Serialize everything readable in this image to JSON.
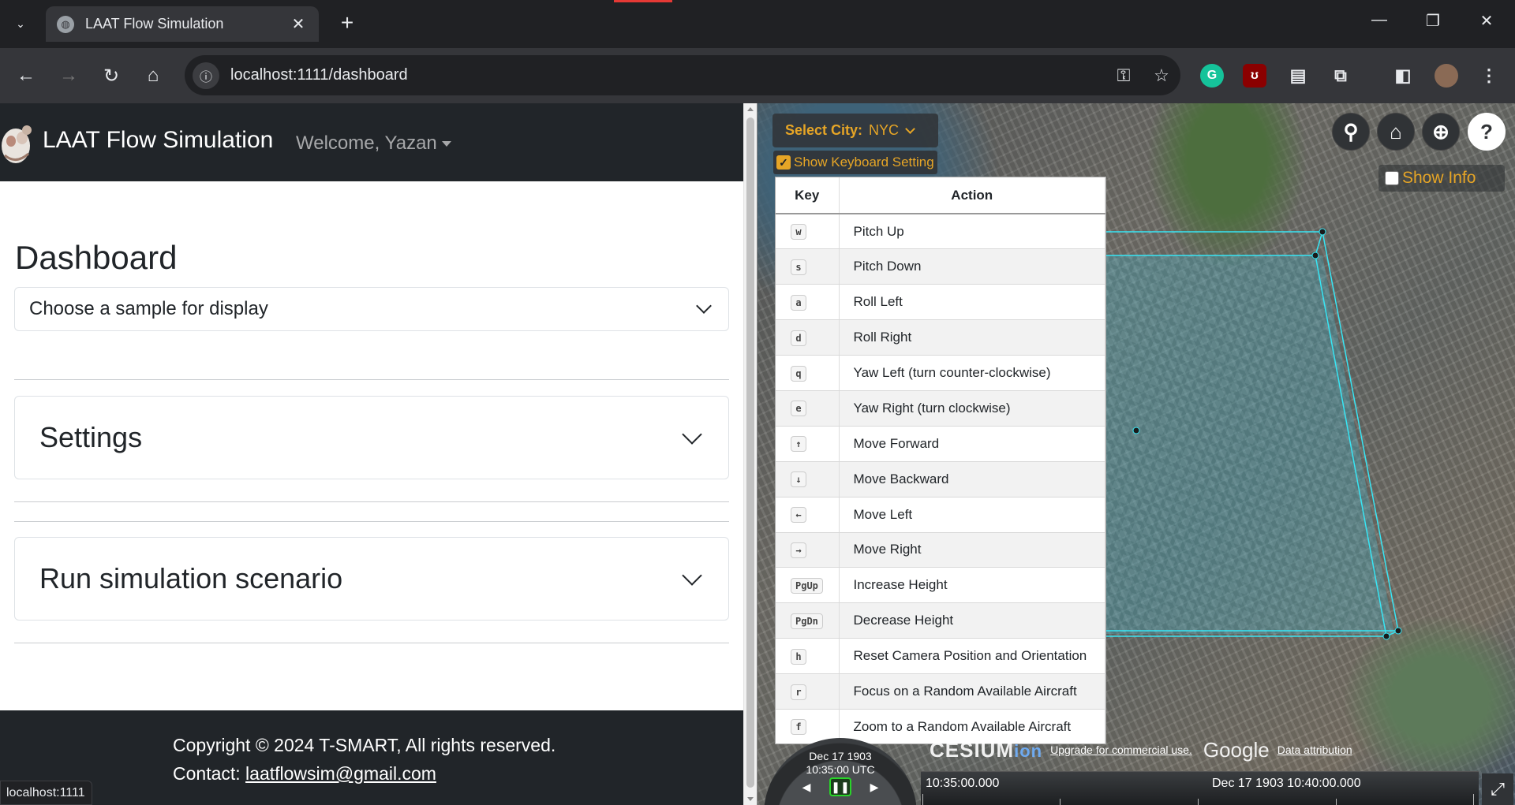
{
  "browser": {
    "tab_title": "LAAT Flow Simulation",
    "url": "localhost:1111/dashboard",
    "status_url": "localhost:1111"
  },
  "app": {
    "brand": "LAAT Flow Simulation",
    "welcome": "Welcome, Yazan"
  },
  "dashboard": {
    "title": "Dashboard",
    "sample_select": "Choose a sample for display",
    "sections": [
      {
        "title": "Settings"
      },
      {
        "title": "Run simulation scenario"
      }
    ]
  },
  "footer": {
    "copyright": "Copyright © 2024 T-SMART, All rights reserved.",
    "contact_label": "Contact: ",
    "contact_email": "laatflowsim@gmail.com"
  },
  "viewer": {
    "city_label": "Select City:",
    "city_value": "NYC",
    "keyboard_toggle": "Show Keyboard Setting",
    "keyboard_toggle_checked": true,
    "show_info": "Show Info",
    "show_info_checked": false,
    "keyboard_table": {
      "headers": [
        "Key",
        "Action"
      ],
      "rows": [
        {
          "key": "w",
          "action": "Pitch Up"
        },
        {
          "key": "s",
          "action": "Pitch Down"
        },
        {
          "key": "a",
          "action": "Roll Left"
        },
        {
          "key": "d",
          "action": "Roll Right"
        },
        {
          "key": "q",
          "action": "Yaw Left (turn counter-clockwise)"
        },
        {
          "key": "e",
          "action": "Yaw Right (turn clockwise)"
        },
        {
          "key": "↑",
          "action": "Move Forward"
        },
        {
          "key": "↓",
          "action": "Move Backward"
        },
        {
          "key": "←",
          "action": "Move Left"
        },
        {
          "key": "→",
          "action": "Move Right"
        },
        {
          "key": "PgUp",
          "action": "Increase Height"
        },
        {
          "key": "PgDn",
          "action": "Decrease Height"
        },
        {
          "key": "h",
          "action": "Reset Camera Position and Orientation"
        },
        {
          "key": "r",
          "action": "Focus on a Random Available Aircraft"
        },
        {
          "key": "f",
          "action": "Zoom to a Random Available Aircraft"
        }
      ]
    },
    "clock": {
      "date": "Dec 17 1903",
      "time": "10:35:00 UTC"
    },
    "credits": {
      "cesium": "CESIUM",
      "ion": "ion",
      "upgrade": "Upgrade for commercial use.",
      "google": "Google",
      "attribution": "Data attribution"
    },
    "timeline": {
      "start_label": "10:35:00.000",
      "end_label": "Dec 17 1903 10:40:00.000"
    }
  },
  "colors": {
    "navbar": "#212529",
    "accent": "#e6a526",
    "boundary": "#37e6f5"
  }
}
